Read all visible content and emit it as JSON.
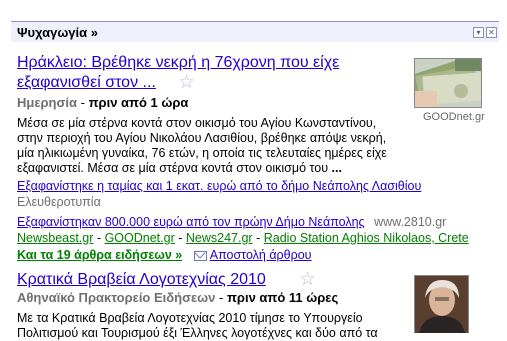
{
  "section": {
    "title": "Ψυχαγωγία »",
    "collapse_icon": "minimize-icon",
    "close_icon": "close-icon"
  },
  "story1": {
    "title_line1": "Ηράκλειο: Βρέθηκε νεκρή η 76χρονη που είχε",
    "title_line2": "εξαφανισθεί στον ...",
    "star_icon": "star-icon",
    "source": "Ημερησία",
    "separator": "-",
    "time": "πριν από 1 ώρα",
    "snippet_lines": [
      "Μέσα σε μία στέρνα κοντά στον οικισμό του Αγίου Κωνσταντίνου,",
      "στην περιοχή του Αγίου Νικολάου Λασιθίου, βρέθηκε απόψε νεκρή,",
      "μία ηλικιωμένη γυναίκα, 76 ετών, η οποία τις τελευταίες ημέρες είχε",
      "εξαφανιστεί. Μέσα σε μία στέρνα κοντά στον οικισμό του",
      "..."
    ],
    "related1": "Εξαφανίστηκε η ταμίας και 1 εκατ. ευρώ από το δήμο Νεάπολης Λασιθίου",
    "related1_source": "Ελευθεροτυπία",
    "related2": "Εξαφανίστηκαν 800.000 ευρώ από τον πρώην Δήμο Νεάπολης",
    "related2_source": "www.2810.gr",
    "sources": [
      "Newsbeast.gr",
      "GOODnet.gr",
      "News247.gr",
      "Radio Station Aghios Nikolaos, Crete"
    ],
    "source_sep": "-",
    "more_link": "Και τα 19 άρθρα ειδήσεων »",
    "email_icon": "mail-icon",
    "email_link": "Αποστολή άρθρου",
    "thumb_caption": "GOODnet.gr"
  },
  "story2": {
    "title": "Κρατικά Βραβεία Λογοτεχνίας 2010",
    "star_icon": "star-icon",
    "source": "Αθηναϊκό Πρακτορείο Ειδήσεων",
    "separator": "-",
    "time": "πριν από 11 ώρες",
    "snippet_lines": [
      "Με τα Κρατικά Βραβεία Λογοτεχνίας 2010 τίμησε το Υπουργείο",
      "Πολιτισμού και Τουρισμού έξι Έλληνες λογοτέχνες και δύο από τα"
    ]
  }
}
